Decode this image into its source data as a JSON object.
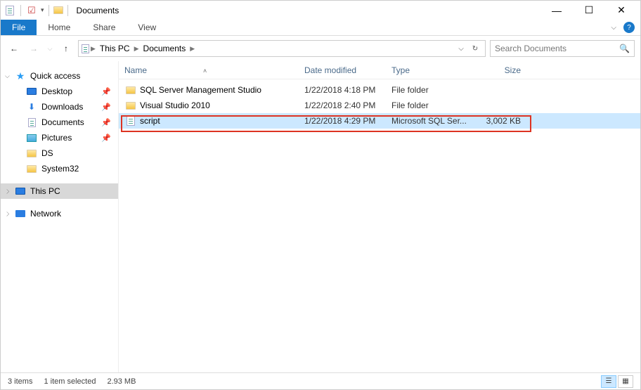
{
  "titlebar": {
    "title": "Documents",
    "sys": {
      "min": "—",
      "max": "☐",
      "close": "✕"
    }
  },
  "ribbon": {
    "file": "File",
    "tabs": [
      "Home",
      "Share",
      "View"
    ]
  },
  "nav": {
    "back": "←",
    "forward": "→",
    "up": "↑"
  },
  "breadcrumb": {
    "items": [
      "This PC",
      "Documents"
    ]
  },
  "search": {
    "placeholder": "Search Documents"
  },
  "sidebar": {
    "quick_access": "Quick access",
    "items": [
      {
        "label": "Desktop",
        "pin": true,
        "icon": "monitor"
      },
      {
        "label": "Downloads",
        "pin": true,
        "icon": "down"
      },
      {
        "label": "Documents",
        "pin": true,
        "icon": "doc"
      },
      {
        "label": "Pictures",
        "pin": true,
        "icon": "pic"
      },
      {
        "label": "DS",
        "pin": false,
        "icon": "folder"
      },
      {
        "label": "System32",
        "pin": false,
        "icon": "folder"
      }
    ],
    "this_pc": "This PC",
    "network": "Network"
  },
  "columns": {
    "name": "Name",
    "date": "Date modified",
    "type": "Type",
    "size": "Size"
  },
  "files": [
    {
      "name": "SQL Server Management Studio",
      "date": "1/22/2018 4:18 PM",
      "type": "File folder",
      "size": "",
      "icon": "folder",
      "selected": false
    },
    {
      "name": "Visual Studio 2010",
      "date": "1/22/2018 2:40 PM",
      "type": "File folder",
      "size": "",
      "icon": "folder",
      "selected": false
    },
    {
      "name": "script",
      "date": "1/22/2018 4:29 PM",
      "type": "Microsoft SQL Ser...",
      "size": "3,002 KB",
      "icon": "file",
      "selected": true
    }
  ],
  "status": {
    "count": "3 items",
    "selection": "1 item selected",
    "size": "2.93 MB"
  }
}
